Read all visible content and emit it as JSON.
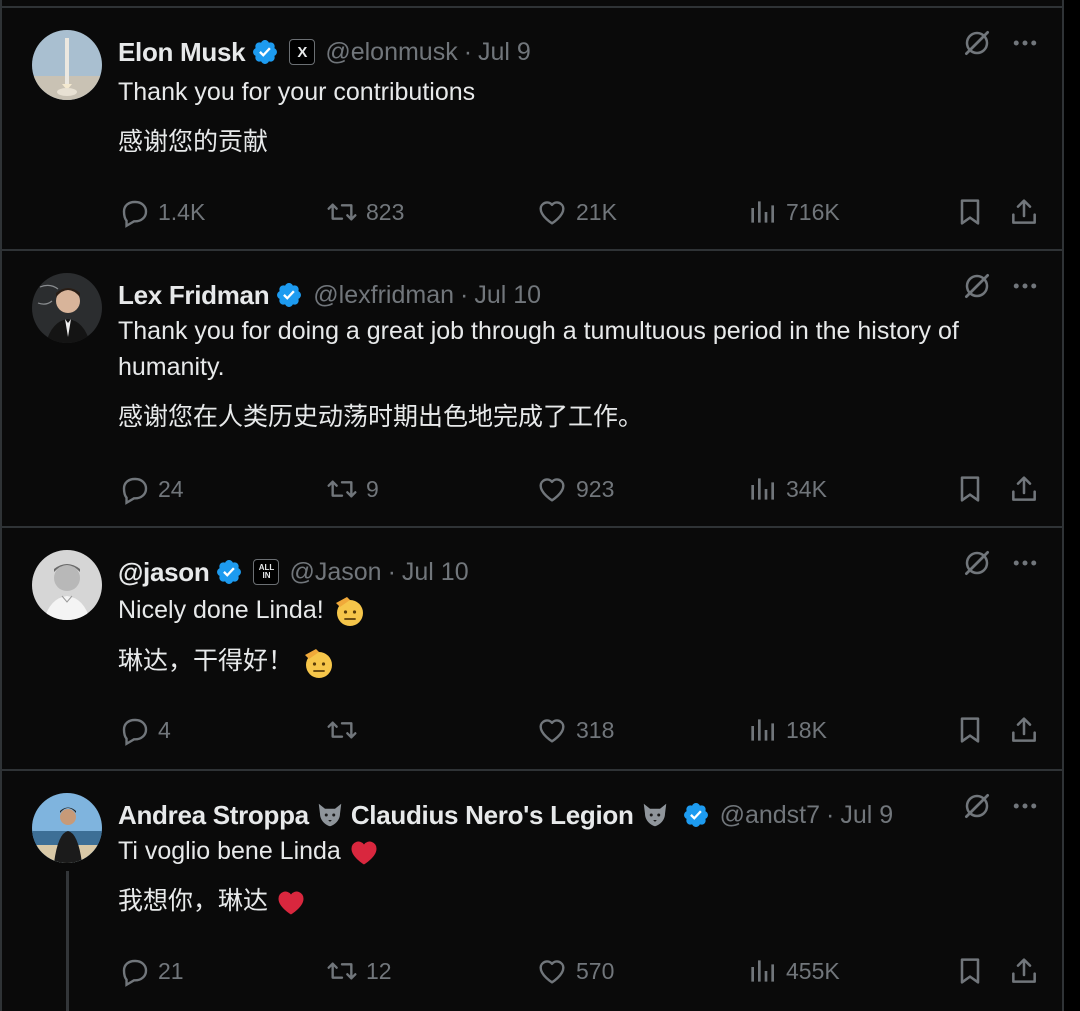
{
  "tweets": [
    {
      "name": "Elon Musk",
      "verified": true,
      "affiliation": "X",
      "handle": "@elonmusk",
      "date": "Jul 9",
      "text_en": "Thank you for your contributions",
      "text_zh": "感谢您的贡献",
      "replies": "1.4K",
      "retweets": "823",
      "likes": "21K",
      "views": "716K"
    },
    {
      "name": "Lex Fridman",
      "verified": true,
      "handle": "@lexfridman",
      "date": "Jul 10",
      "text_en": "Thank you for doing a great job through a tumultuous period in the history of humanity.",
      "text_zh": "感谢您在人类历史动荡时期出色地完成了工作。",
      "replies": "24",
      "retweets": "9",
      "likes": "923",
      "views": "34K"
    },
    {
      "name": "@jason",
      "verified": true,
      "affiliation": "ALL IN",
      "handle": "@Jason",
      "date": "Jul 10",
      "text_en": "Nicely done Linda!",
      "text_zh": "琳达，干得好！",
      "replies": "4",
      "retweets": "",
      "likes": "318",
      "views": "18K"
    },
    {
      "name": "Andrea Stroppa",
      "name_suffix": "Claudius Nero's Legion",
      "verified": true,
      "handle": "@andst7",
      "date": "Jul 9",
      "text_en": "Ti voglio bene Linda",
      "text_zh": "我想你，琳达",
      "replies": "21",
      "retweets": "12",
      "likes": "570",
      "views": "455K"
    }
  ],
  "colors": {
    "background": "#000000",
    "text": "#e7e9ea",
    "muted": "#71767b",
    "verified": "#1d9bf0",
    "heart": "#d9273e",
    "divider": "#2f3336"
  }
}
